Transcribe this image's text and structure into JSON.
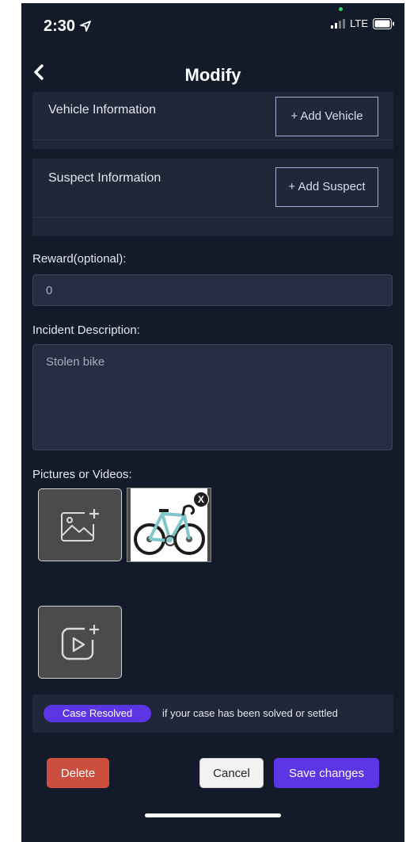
{
  "status_bar": {
    "time": "2:30",
    "network": "LTE"
  },
  "header": {
    "title": "Modify"
  },
  "vehicle": {
    "label": "Vehicle Information",
    "add_label": "+ Add Vehicle"
  },
  "suspect": {
    "label": "Suspect Information",
    "add_label": "+ Add Suspect"
  },
  "reward": {
    "label": "Reward(optional):",
    "value": "0"
  },
  "description": {
    "label": "Incident Description:",
    "value": "Stolen bike"
  },
  "media": {
    "label": "Pictures or Videos:",
    "remove_label": "X"
  },
  "resolved": {
    "toggle_label": "Case Resolved",
    "hint": "if your case has been solved or settled"
  },
  "actions": {
    "delete": "Delete",
    "cancel": "Cancel",
    "save": "Save changes"
  },
  "colors": {
    "accent": "#5b35e6",
    "delete": "#cc4e3e",
    "background": "#131a29"
  }
}
